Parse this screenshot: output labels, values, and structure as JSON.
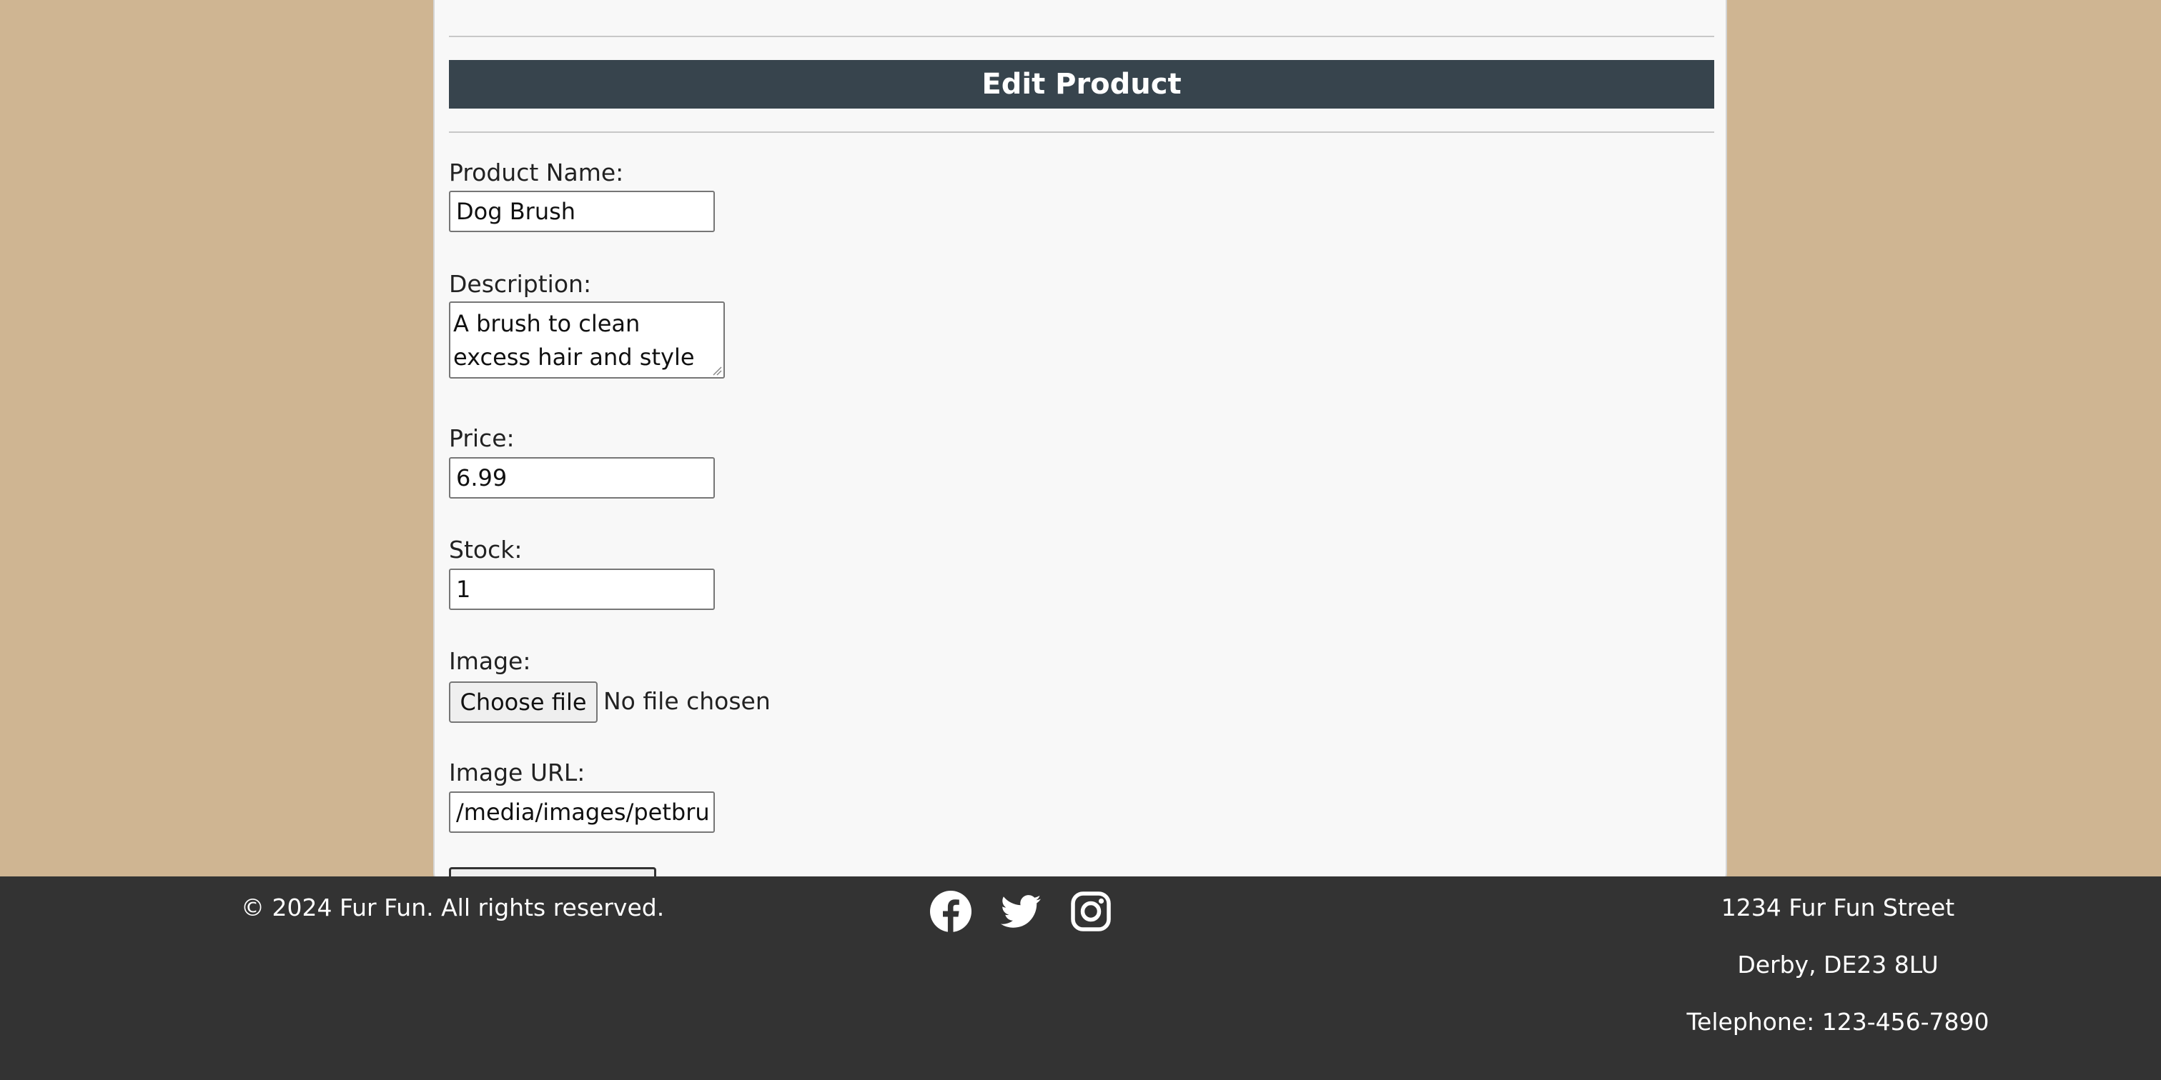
{
  "form": {
    "title": "Edit Product",
    "product_name": {
      "label": "Product Name:",
      "value": "Dog Brush"
    },
    "description": {
      "label": "Description:",
      "value": "A brush to clean excess hair and style pets fur,"
    },
    "price": {
      "label": "Price:",
      "value": "6.99"
    },
    "stock": {
      "label": "Stock:",
      "value": "1"
    },
    "image": {
      "label": "Image:",
      "button_label": "Choose file",
      "status": "No file chosen"
    },
    "image_url": {
      "label": "Image URL:",
      "value": "/media/images/petbru"
    }
  },
  "footer": {
    "copyright": "© 2024 Fur Fun. All rights reserved.",
    "social_icons": [
      "facebook-icon",
      "twitter-icon",
      "instagram-icon"
    ],
    "address_street": "1234 Fur Fun Street",
    "address_city": "Derby, DE23 8LU",
    "telephone": "Telephone: 123-456-7890"
  },
  "colors": {
    "page_background": "#cfb592",
    "card_background": "#f8f8f8",
    "title_bar": "#37444d",
    "footer_background": "#333333"
  }
}
